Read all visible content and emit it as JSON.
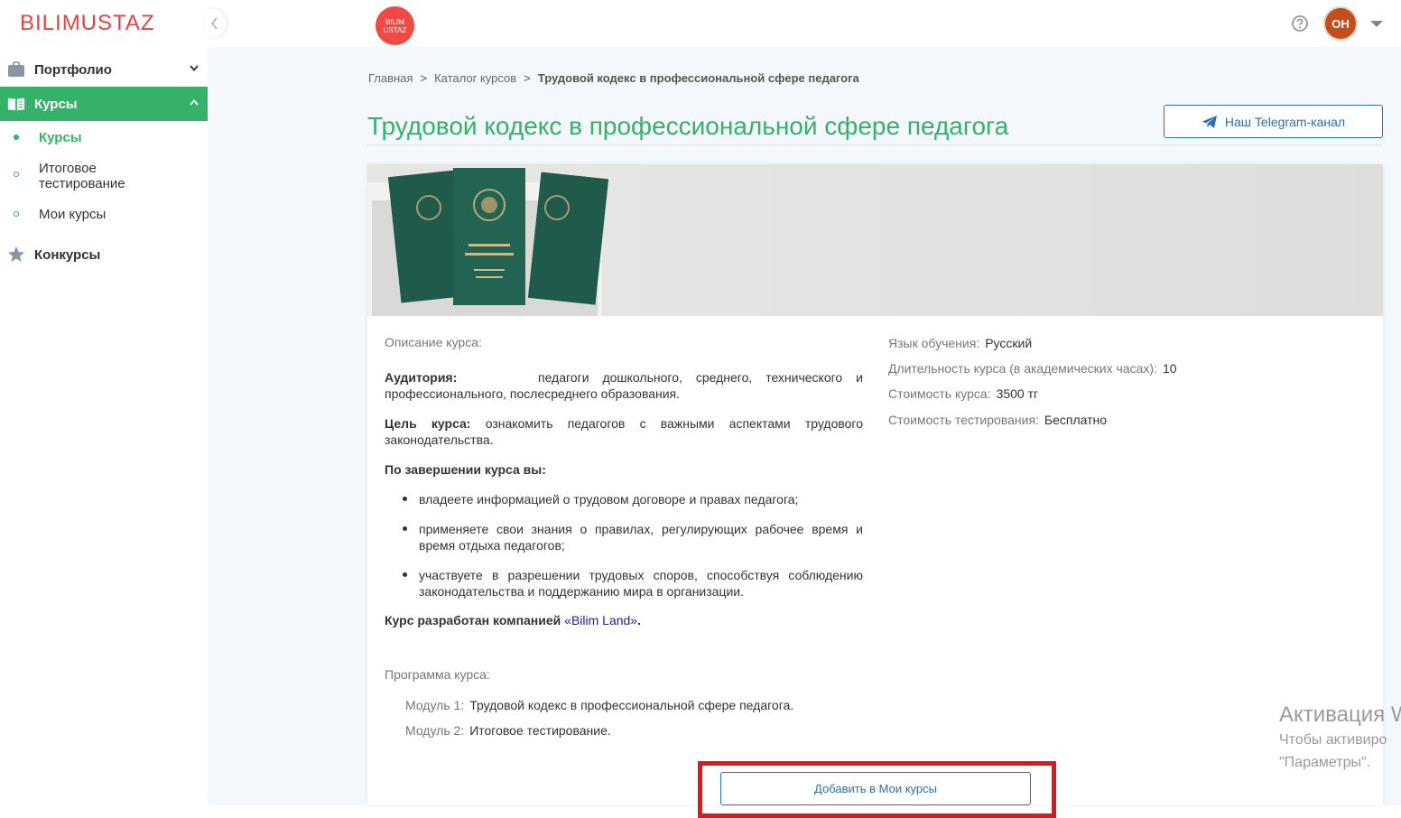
{
  "header": {
    "logo": "BILIMUSTAZ",
    "center_logo": [
      "BILIM",
      "USTAZ"
    ],
    "avatar_initials": "OH"
  },
  "sidebar": {
    "portfolio": "Портфолио",
    "courses": "Курсы",
    "sub": {
      "courses": "Курсы",
      "final_test": "Итоговое тестирование",
      "my_courses": "Мои курсы"
    },
    "contests": "Конкурсы"
  },
  "breadcrumb": {
    "home": "Главная",
    "catalog": "Каталог курсов",
    "current": "Трудовой кодекс в профессиональной сфере педагога",
    "separator": ">"
  },
  "page": {
    "title": "Трудовой кодекс в профессиональной сфере педагога",
    "telegram_button": "Наш Telegram-канал"
  },
  "description": {
    "label": "Описание курса:",
    "audience_label": "Аудитория:",
    "audience_text": "педагоги дошкольного, среднего, технического и профессионального, послесреднего образования.",
    "goal_label": "Цель курса:",
    "goal_text": "ознакомить педагогов с важными аспектами трудового законодательства.",
    "outcomes_title": "По завершении курса вы:",
    "outcomes": [
      "владеете информацией о трудовом договоре и правах педагога;",
      "применяете свои знания о правилах, регулирующих рабочее время и время отдыха педагогов;",
      "участвуете в разрешении трудовых споров, способствуя соблюдению законодательства и поддержанию мира в организации."
    ],
    "developer_prefix": "Курс разработан компанией ",
    "developer_link": "«Bilim Land»",
    "developer_suffix": "."
  },
  "info": {
    "language_key": "Язык обучения:",
    "language_val": "Русский",
    "duration_key": "Длительность курса (в академических часах):",
    "duration_val": "10",
    "price_key": "Стоимость курса:",
    "price_val": "3500 тг",
    "test_price_key": "Стоимость тестирования:",
    "test_price_val": "Бесплатно"
  },
  "program": {
    "label": "Программа курса:",
    "modules": [
      {
        "key": "Модуль 1:",
        "value": "Трудовой кодекс в профессиональной сфере педагога."
      },
      {
        "key": "Модуль 2:",
        "value": "Итоговое тестирование."
      }
    ]
  },
  "actions": {
    "add_button": "Добавить в Мои курсы"
  },
  "watermark": {
    "line1": "Активация W",
    "line2": "Чтобы активиро",
    "line3": "\"Параметры\"."
  },
  "colors": {
    "brand_red": "#e8413d",
    "accent_green": "#35b16a",
    "link_blue": "#2a6fb3",
    "highlight_red": "#e0171f"
  }
}
